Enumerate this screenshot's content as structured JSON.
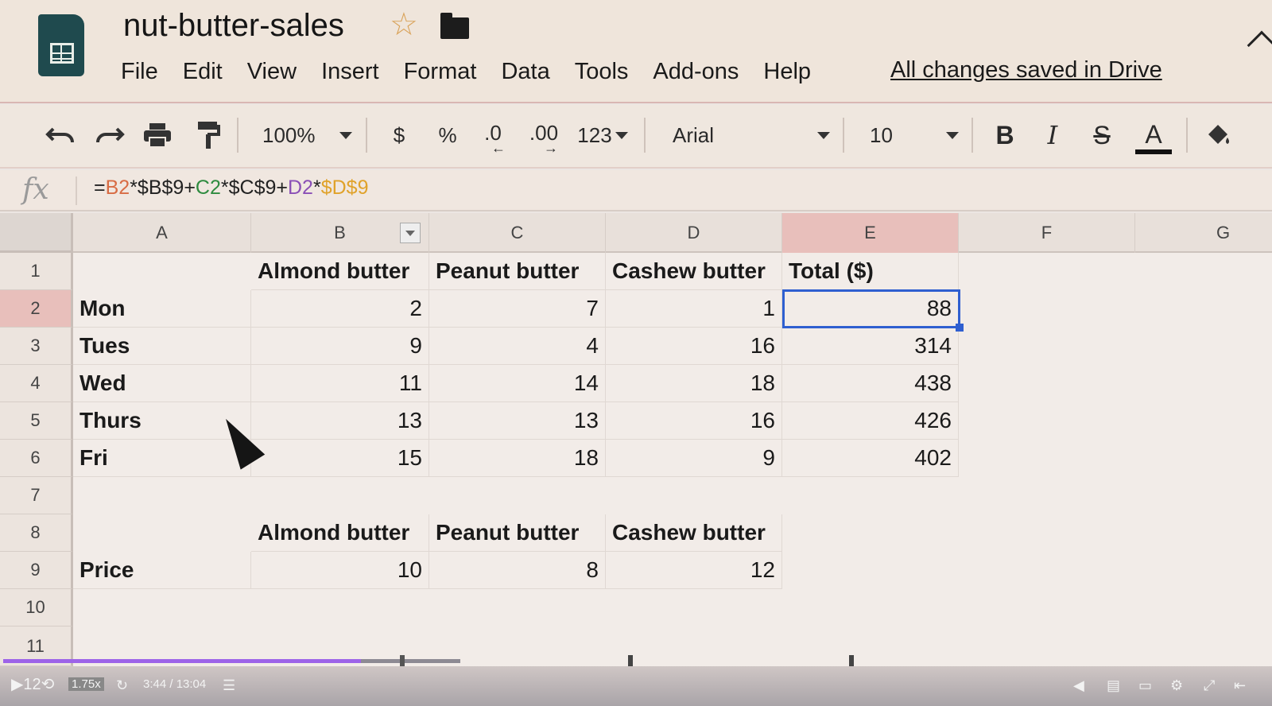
{
  "header": {
    "title": "nut-butter-sales",
    "star_glyph": "☆",
    "save_status": "All changes saved in Drive",
    "menu": [
      "File",
      "Edit",
      "View",
      "Insert",
      "Format",
      "Data",
      "Tools",
      "Add-ons",
      "Help"
    ]
  },
  "toolbar": {
    "zoom": "100%",
    "currency": "$",
    "percent": "%",
    "dec_decrease": ".0",
    "dec_increase": ".00",
    "more_formats": "123",
    "font": "Arial",
    "font_size": "10",
    "bold": "B",
    "italic": "I",
    "strike": "S",
    "text_color": "A",
    "icons": [
      "undo-icon",
      "redo-icon",
      "print-icon",
      "paint-format-icon",
      "fill-color-icon"
    ]
  },
  "formula_bar": {
    "fx": "fx",
    "parts": [
      "=",
      "B2",
      "*$B$9+",
      "C2",
      "*$C$9+",
      "D2",
      "*",
      "$D$9"
    ]
  },
  "grid": {
    "columns": [
      "A",
      "B",
      "C",
      "D",
      "E",
      "F",
      "G"
    ],
    "rows": [
      "1",
      "2",
      "3",
      "4",
      "5",
      "6",
      "7",
      "8",
      "9",
      "10",
      "11"
    ],
    "headers_row1": [
      "Almond butter",
      "Peanut butter",
      "Cashew butter",
      "Total ($)"
    ],
    "data": [
      {
        "day": "Mon",
        "almond": "2",
        "peanut": "7",
        "cashew": "1",
        "total": "88"
      },
      {
        "day": "Tues",
        "almond": "9",
        "peanut": "4",
        "cashew": "16",
        "total": "314"
      },
      {
        "day": "Wed",
        "almond": "11",
        "peanut": "14",
        "cashew": "18",
        "total": "438"
      },
      {
        "day": "Thurs",
        "almond": "13",
        "peanut": "13",
        "cashew": "16",
        "total": "426"
      },
      {
        "day": "Fri",
        "almond": "15",
        "peanut": "18",
        "cashew": "9",
        "total": "402"
      }
    ],
    "headers_row8": [
      "Almond butter",
      "Peanut butter",
      "Cashew butter"
    ],
    "price_label": "Price",
    "prices": [
      "10",
      "8",
      "12"
    ],
    "selected_cell": "E2"
  },
  "video_bar": {
    "left": "▶12⟲",
    "speed": "1.75x",
    "time": "3:44 / 13:04"
  },
  "colors": {
    "selection": "#2f5fd0",
    "active_header": "#e8bfbb",
    "progress": "#9d63e8"
  }
}
